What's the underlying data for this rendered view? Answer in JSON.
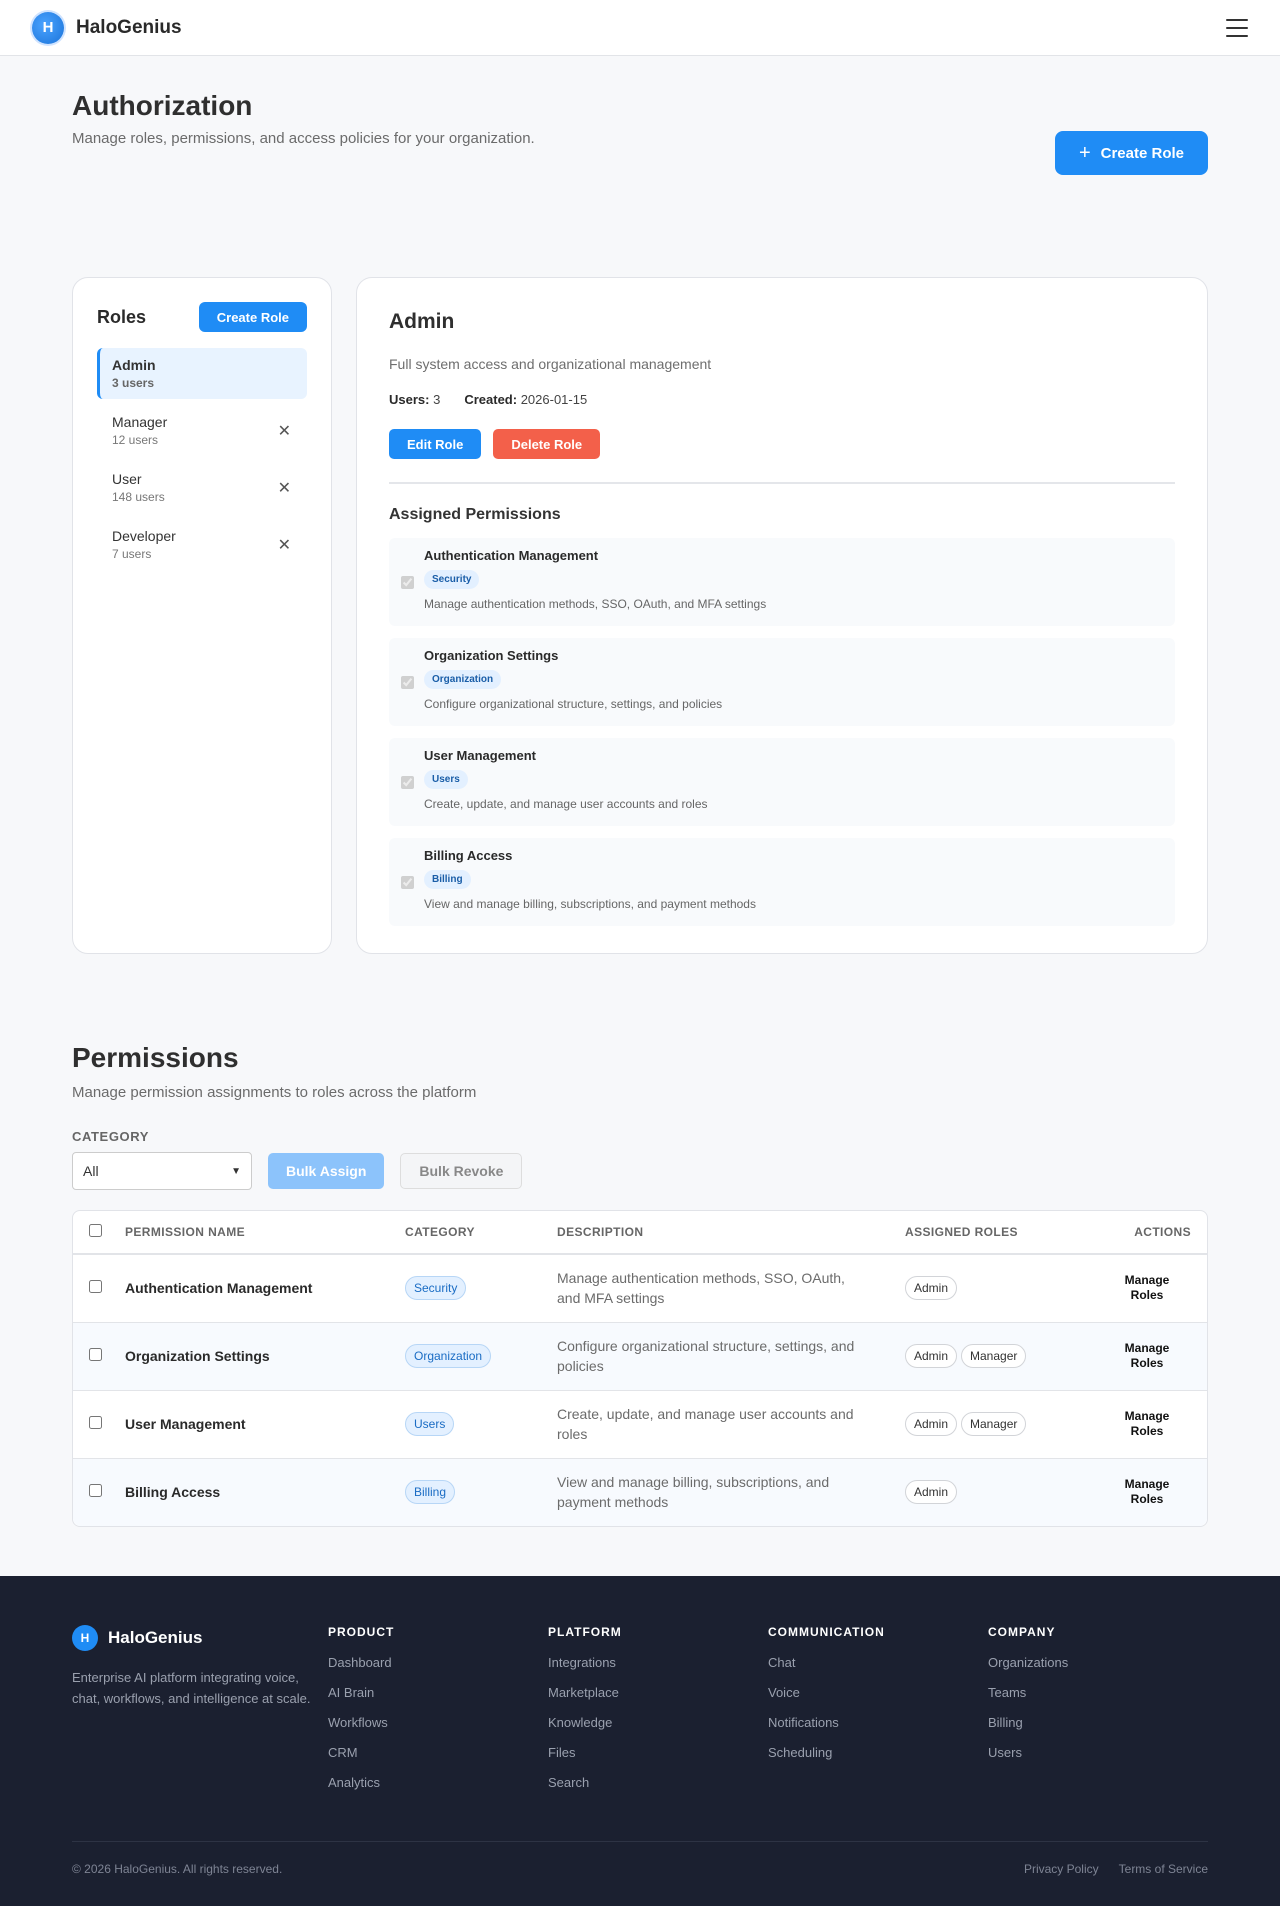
{
  "header": {
    "logo_letter": "H",
    "brand": "HaloGenius"
  },
  "page": {
    "title": "Authorization",
    "subtitle": "Manage roles, permissions, and access policies for your organization.",
    "create_role_label": "Create Role"
  },
  "roles_panel": {
    "title": "Roles",
    "create_label": "Create Role",
    "items": [
      {
        "name": "Admin",
        "users": "3 users",
        "active": true
      },
      {
        "name": "Manager",
        "users": "12 users"
      },
      {
        "name": "User",
        "users": "148 users"
      },
      {
        "name": "Developer",
        "users": "7 users"
      }
    ]
  },
  "detail": {
    "title": "Admin",
    "description": "Full system access and organizational management",
    "users_label": "Users:",
    "users_value": "3",
    "created_label": "Created:",
    "created_value": "2026-01-15",
    "edit_label": "Edit Role",
    "delete_label": "Delete Role",
    "assigned_title": "Assigned Permissions",
    "permissions": [
      {
        "name": "Authentication Management",
        "tag": "Security",
        "desc": "Manage authentication methods, SSO, OAuth, and MFA settings"
      },
      {
        "name": "Organization Settings",
        "tag": "Organization",
        "desc": "Configure organizational structure, settings, and policies"
      },
      {
        "name": "User Management",
        "tag": "Users",
        "desc": "Create, update, and manage user accounts and roles"
      },
      {
        "name": "Billing Access",
        "tag": "Billing",
        "desc": "View and manage billing, subscriptions, and payment methods"
      }
    ]
  },
  "permissions": {
    "title": "Permissions",
    "subtitle": "Manage permission assignments to roles across the platform",
    "category_label": "CATEGORY",
    "category_value": "All",
    "bulk_assign": "Bulk Assign",
    "bulk_revoke": "Bulk Revoke",
    "columns": [
      "PERMISSION NAME",
      "CATEGORY",
      "DESCRIPTION",
      "ASSIGNED ROLES",
      "ACTIONS"
    ],
    "rows": [
      {
        "name": "Authentication Management",
        "category": "Security",
        "desc": "Manage authentication methods, SSO, OAuth, and MFA settings",
        "roles": [
          "Admin"
        ],
        "action": "Manage Roles"
      },
      {
        "name": "Organization Settings",
        "category": "Organization",
        "desc": "Configure organizational structure, settings, and policies",
        "roles": [
          "Admin",
          "Manager"
        ],
        "action": "Manage Roles"
      },
      {
        "name": "User Management",
        "category": "Users",
        "desc": "Create, update, and manage user accounts and roles",
        "roles": [
          "Admin",
          "Manager"
        ],
        "action": "Manage Roles"
      },
      {
        "name": "Billing Access",
        "category": "Billing",
        "desc": "View and manage billing, subscriptions, and payment methods",
        "roles": [
          "Admin"
        ],
        "action": "Manage Roles"
      }
    ]
  },
  "footer": {
    "brand": "HaloGenius",
    "logo_letter": "H",
    "tagline": "Enterprise AI platform integrating voice, chat, workflows, and intelligence at scale.",
    "columns": [
      {
        "title": "PRODUCT",
        "links": [
          "Dashboard",
          "AI Brain",
          "Workflows",
          "CRM",
          "Analytics"
        ]
      },
      {
        "title": "PLATFORM",
        "links": [
          "Integrations",
          "Marketplace",
          "Knowledge",
          "Files",
          "Search"
        ]
      },
      {
        "title": "COMMUNICATION",
        "links": [
          "Chat",
          "Voice",
          "Notifications",
          "Scheduling"
        ]
      },
      {
        "title": "COMPANY",
        "links": [
          "Organizations",
          "Teams",
          "Billing",
          "Users"
        ]
      }
    ],
    "copyright": "© 2026 HaloGenius. All rights reserved.",
    "privacy": "Privacy Policy",
    "terms": "Terms of Service"
  }
}
